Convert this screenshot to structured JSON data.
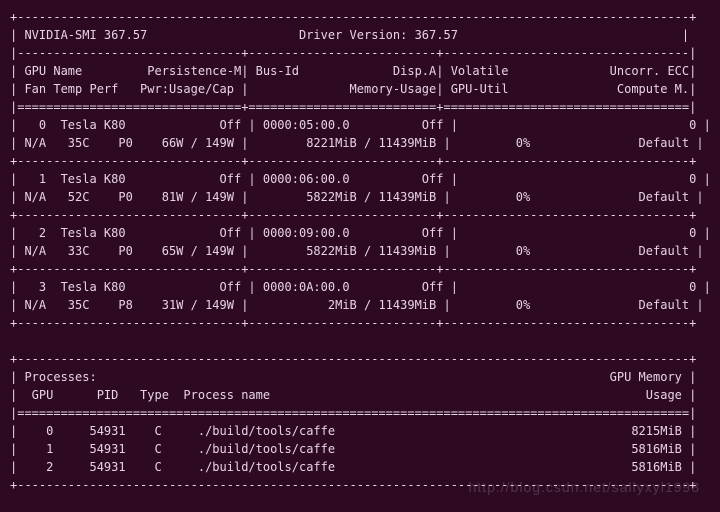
{
  "header": {
    "smi_label": "NVIDIA-SMI",
    "smi_version": "367.57",
    "driver_label": "Driver Version:",
    "driver_version": "367.57"
  },
  "columns": {
    "row1": {
      "gpu": "GPU",
      "name": "Name",
      "persistence": "Persistence-M",
      "busid": "Bus-Id",
      "dispa": "Disp.A",
      "volatile": "Volatile",
      "uncorr": "Uncorr. ECC"
    },
    "row2": {
      "fan": "Fan",
      "temp": "Temp",
      "perf": "Perf",
      "pwr": "Pwr:Usage/Cap",
      "mem": "Memory-Usage",
      "gputil": "GPU-Util",
      "compute": "Compute M."
    }
  },
  "gpus": [
    {
      "idx": "0",
      "name": "Tesla K80",
      "persist": "Off",
      "busid": "0000:05:00.0",
      "disp": "Off",
      "ecc": "0",
      "fan": "N/A",
      "temp": "35C",
      "perf": "P0",
      "pwr": "66W / 149W",
      "mem": "8221MiB / 11439MiB",
      "util": "0%",
      "compute": "Default"
    },
    {
      "idx": "1",
      "name": "Tesla K80",
      "persist": "Off",
      "busid": "0000:06:00.0",
      "disp": "Off",
      "ecc": "0",
      "fan": "N/A",
      "temp": "52C",
      "perf": "P0",
      "pwr": "81W / 149W",
      "mem": "5822MiB / 11439MiB",
      "util": "0%",
      "compute": "Default"
    },
    {
      "idx": "2",
      "name": "Tesla K80",
      "persist": "Off",
      "busid": "0000:09:00.0",
      "disp": "Off",
      "ecc": "0",
      "fan": "N/A",
      "temp": "33C",
      "perf": "P0",
      "pwr": "65W / 149W",
      "mem": "5822MiB / 11439MiB",
      "util": "0%",
      "compute": "Default"
    },
    {
      "idx": "3",
      "name": "Tesla K80",
      "persist": "Off",
      "busid": "0000:0A:00.0",
      "disp": "Off",
      "ecc": "0",
      "fan": "N/A",
      "temp": "35C",
      "perf": "P8",
      "pwr": "31W / 149W",
      "mem": "2MiB / 11439MiB",
      "util": "0%",
      "compute": "Default"
    }
  ],
  "processes": {
    "title": "Processes:",
    "memhdr1": "GPU Memory",
    "memhdr2": "Usage",
    "cols": {
      "gpu": "GPU",
      "pid": "PID",
      "type": "Type",
      "pname": "Process name"
    },
    "rows": [
      {
        "gpu": "0",
        "pid": "54931",
        "type": "C",
        "pname": "./build/tools/caffe",
        "mem": "8215MiB"
      },
      {
        "gpu": "1",
        "pid": "54931",
        "type": "C",
        "pname": "./build/tools/caffe",
        "mem": "5816MiB"
      },
      {
        "gpu": "2",
        "pid": "54931",
        "type": "C",
        "pname": "./build/tools/caffe",
        "mem": "5816MiB"
      }
    ]
  },
  "watermark": "http://blog.csdn.net/sallyxyl1993"
}
